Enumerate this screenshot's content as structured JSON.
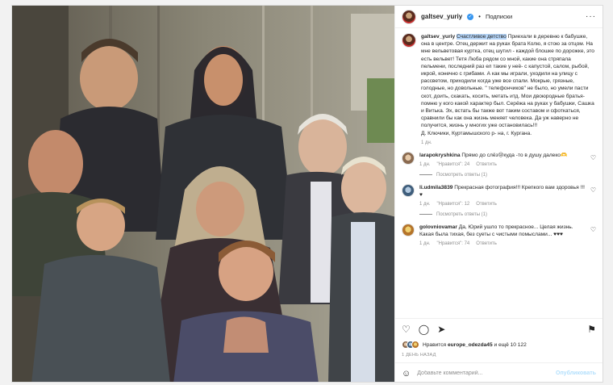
{
  "header": {
    "username": "galtsev_yuriy",
    "verified_mark": "✓",
    "separator": "•",
    "follow_label": "Подписки",
    "more": "···"
  },
  "caption": {
    "username": "galtsev_yuriy",
    "highlight": "Счастливое детство",
    "text": " Приехали в деревню к бабушке, она в центре. Отец держит на руках брата Колю, я стою за отцом. На мне вельветовая куртка, отец шутил - каждой блошке по дорожке, это есть вельвет! Тетя Люба рядом со мной, какие она стряпала пельмени, последний раз ел такие у неё- с капустой, салом, рыбой, икрой, конечно с грибами. А как мы играли, уходили на улицу с рассветом, приходили когда уже все спали. Мокрые, грязные, голодные, но довольные. \" телефончиков\" не было, но умели пасти скот, доить, скакать, косить, метать итд. Мои двоюродные братья- помню у кого какой характер был. Серёжа на руках у бабушки, Сашка и Витька. Эх, встать бы также вот таким составом и сфоткаться, сравнили бы как она жизнь меняет человека. Да уж наверно не получится, жизнь у многих уже остановилась!!!",
    "location": "Д. Ключики, Куртамышского р- на, г. Кургана.",
    "time": "1 дн."
  },
  "comments": [
    {
      "username": "larapokryshkina",
      "text": " Прямо до слёз😢куда -то в душу далеко🫶",
      "time": "1 дн.",
      "likes": "\"Нравится\": 24",
      "reply": "Ответить",
      "replies": "Посмотреть ответы (1)"
    },
    {
      "username": "li.udmila3839",
      "text": " Прекрасная фотография!!! Крепкого вам здоровья !!! ♥",
      "time": "1 дн.",
      "likes": "\"Нравится\": 12",
      "reply": "Ответить",
      "replies": "Посмотреть ответы (1)"
    },
    {
      "username": "golovniovamar",
      "text": " Да, Юрий ушло то прекрасное... Целая жизнь. Какая была тихая, без суеты с чистыми помыслами... ♥♥♥",
      "time": "1 дн.",
      "likes": "\"Нравится\": 74",
      "reply": "Ответить"
    }
  ],
  "icons": {
    "heart": "♡",
    "comment": "◯",
    "share": "➤",
    "bookmark": "⚑",
    "emoji": "☺"
  },
  "likes": {
    "prefix": "Нравится ",
    "user": "europe_odezda45",
    "suffix": " и ещё 10 122"
  },
  "date": "1 ДЕНЬ НАЗАД",
  "add_comment": {
    "placeholder": "Добавьте комментарий...",
    "publish": "Опубликовать"
  },
  "colors": {
    "link_blue": "#3897f0",
    "highlight": "#b4d3f5",
    "border": "#dbdbdb"
  }
}
